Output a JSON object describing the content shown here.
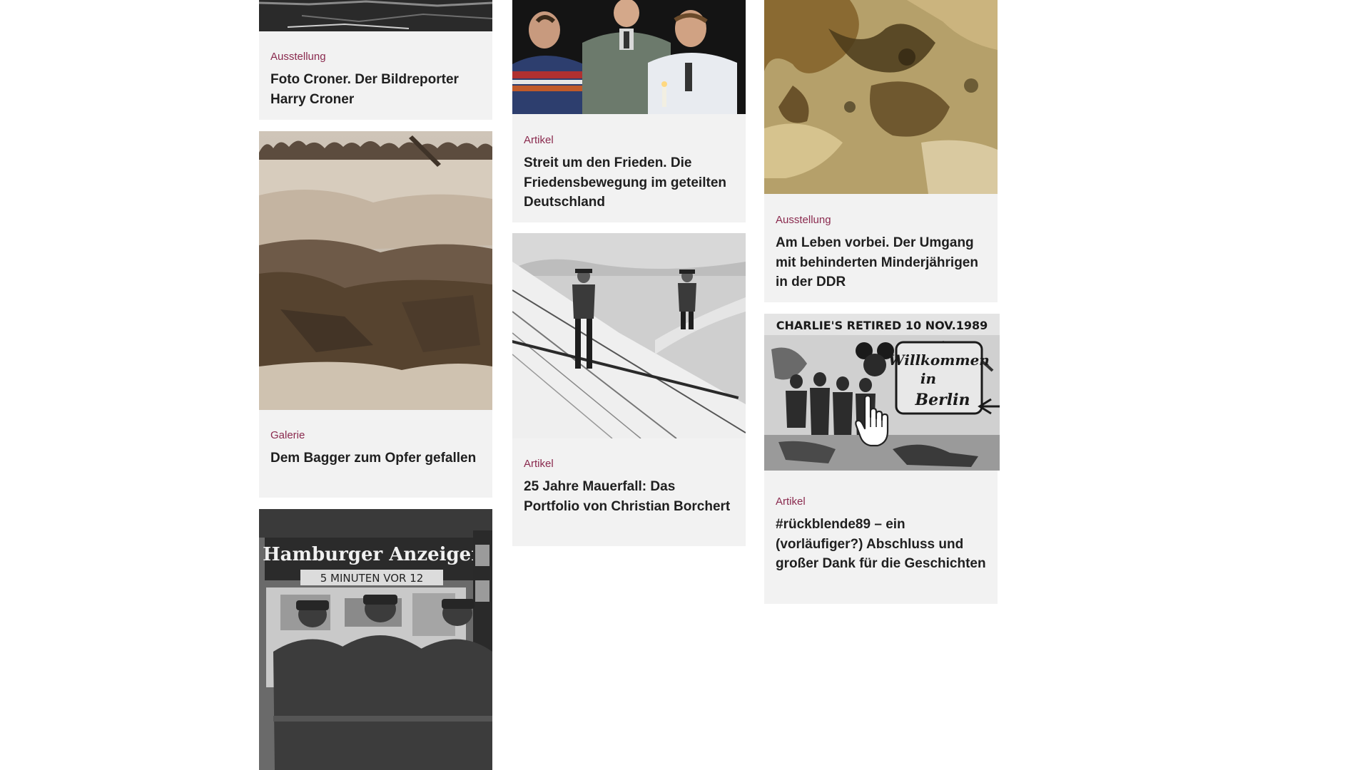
{
  "cards": [
    {
      "type": "Ausstellung",
      "title": "Foto Croner. Der Bildreporter Harry Croner"
    },
    {
      "type": "Galerie",
      "title": "Dem Bagger zum Opfer gefallen"
    },
    {
      "type": "",
      "title": ""
    },
    {
      "type": "Artikel",
      "title": "Streit um den Frieden. Die Friedensbewegung im geteilten Deutschland"
    },
    {
      "type": "Artikel",
      "title": "25 Jahre Mauerfall: Das Portfolio von Christian Borchert"
    },
    {
      "type": "Ausstellung",
      "title": "Am Leben vorbei. Der Umgang mit behinderten Minderjährigen in der DDR"
    },
    {
      "type": "Artikel",
      "title": "#rückblende89 – ein (vorläufiger?) Abschluss und großer Dank für die Geschichten"
    }
  ],
  "photo_text": {
    "anzeiger_title": "Hamburger Anzeiger",
    "anzeiger_subtitle": "5 MINUTEN VOR 12",
    "wall_top": "CHARLIE'S RETIRED 10 NOV.1989",
    "wall_line1": "Willkommen",
    "wall_line2": "in",
    "wall_line3": "Berlin"
  },
  "colors": {
    "card_background": "#f2f2f2",
    "type_label": "#8a2a4e",
    "title_text": "#1f1f1f"
  },
  "cursor_icon": "hand-pointer-icon"
}
